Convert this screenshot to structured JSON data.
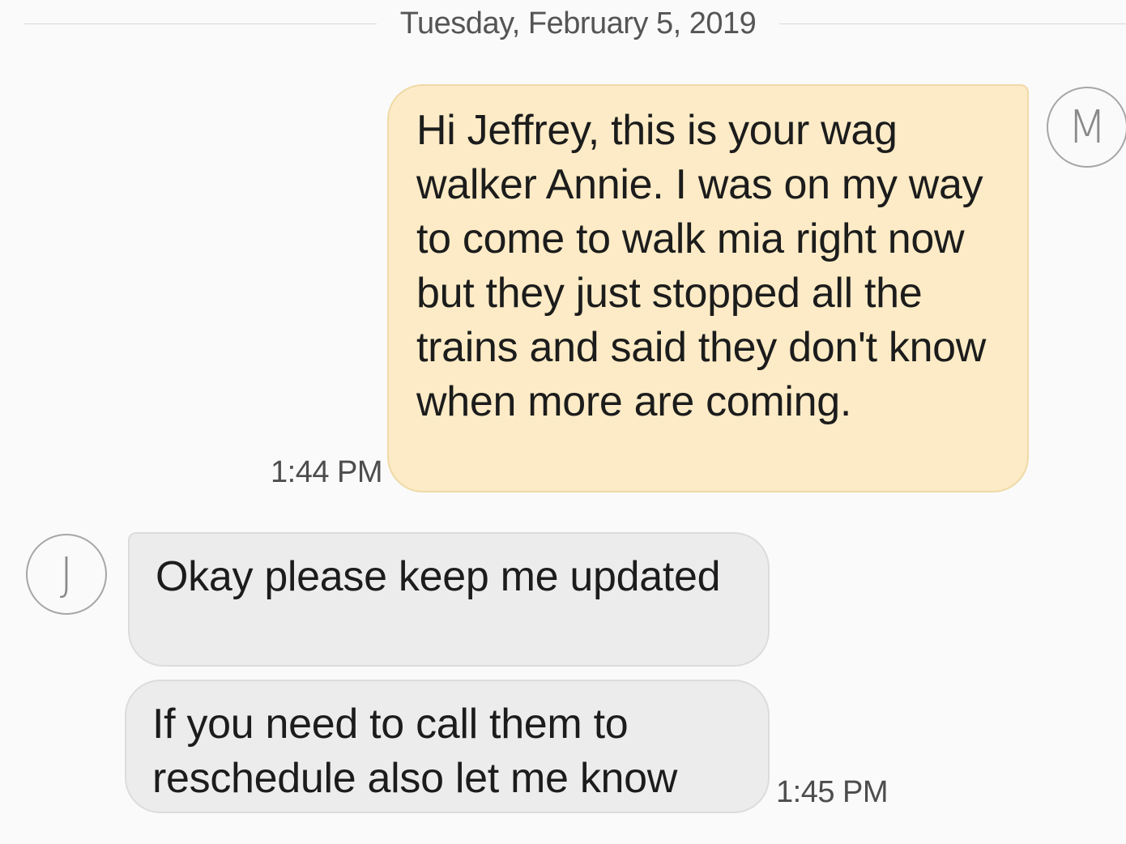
{
  "conversation": {
    "date_divider": "Tuesday, February 5, 2019",
    "messages": [
      {
        "direction": "sent",
        "avatar_letter": "M",
        "text": "Hi Jeffrey, this is your wag walker Annie. I was on my way to come to walk mia right now but they just stopped all the trains and said they don't know when more are coming.",
        "time": "1:44 PM"
      },
      {
        "direction": "received",
        "avatar_letter": "J",
        "text": "Okay please keep me updated",
        "time": ""
      },
      {
        "direction": "received",
        "text": "If you need to call them to reschedule also let me know",
        "time": "1:45 PM"
      }
    ]
  },
  "colors": {
    "background": "#fafafa",
    "sent_bubble": "#fcebc6",
    "received_bubble": "#ececec",
    "avatar_border": "#a6a6a6"
  }
}
